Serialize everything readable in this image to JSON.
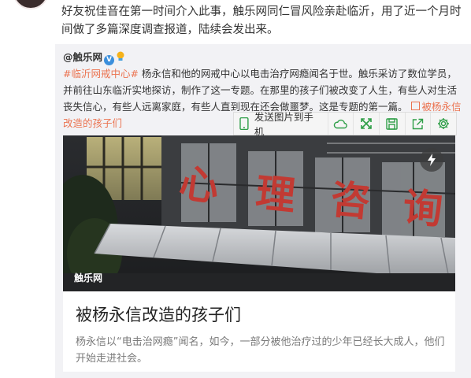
{
  "post": {
    "text": "好友祝佳音在第一时间介入此事，触乐网同仁冒风险亲赴临沂，用了近一个月时间做了多篇深度调查报道，陆续会发出来。"
  },
  "repost": {
    "author": "@触乐网",
    "hashtag": "#临沂网戒中心#",
    "body": " 杨永信和他的网戒中心以电击治疗网瘾闻名于世。触乐采访了数位学员，并前往山东临沂实地探访，制作了这一专题。在那里的孩子们被改变了人生，有些人对生活丧失信心，有些人远离家庭，有些人直到现在还会做噩梦。这是专题的第一篇。",
    "link_text": "被杨永信改造的孩子们"
  },
  "toolbar": {
    "send_label": "发送图片到手机",
    "icons": [
      "phone-icon",
      "cloud-icon",
      "expand-icon",
      "save-icon",
      "share-icon",
      "settings-icon"
    ]
  },
  "card": {
    "watermark": "触乐网",
    "sign_chars": [
      "心",
      "理",
      "咨",
      "询"
    ],
    "title": "被杨永信改造的孩子们",
    "description": "杨永信以“电击治网瘾”闻名，如今，一部分被他治疗过的少年已经长大成人，他们开始走进社会。"
  },
  "colors": {
    "accent": "#eb7350",
    "toolbar_icon": "#2e9e47",
    "sign_red": "#c0392b"
  }
}
